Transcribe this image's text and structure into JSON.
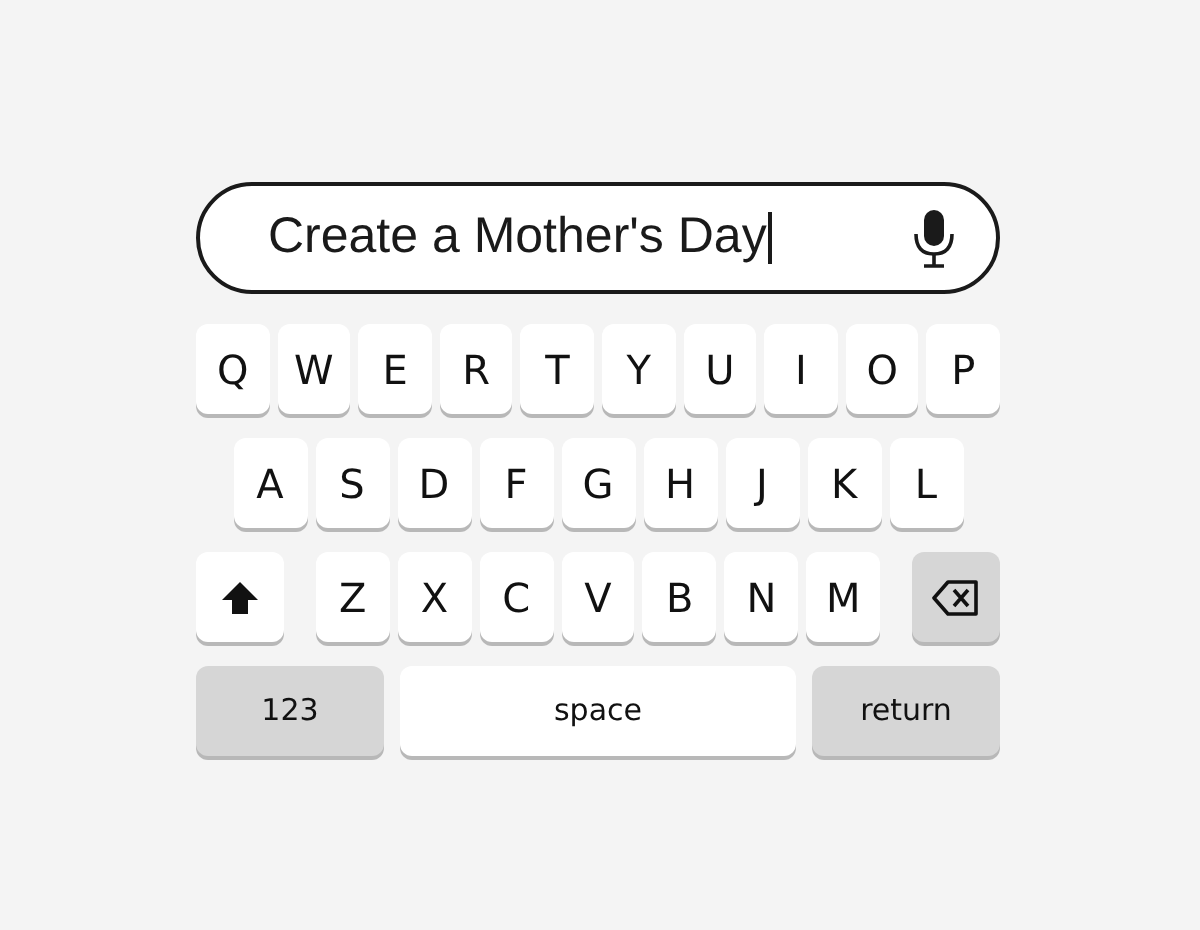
{
  "search": {
    "value": "Create a Mother's Day"
  },
  "keyboard": {
    "rows": [
      [
        {
          "kind": "letter",
          "label": "Q"
        },
        {
          "kind": "letter",
          "label": "W"
        },
        {
          "kind": "letter",
          "label": "E"
        },
        {
          "kind": "letter",
          "label": "R"
        },
        {
          "kind": "letter",
          "label": "T"
        },
        {
          "kind": "letter",
          "label": "Y"
        },
        {
          "kind": "letter",
          "label": "U"
        },
        {
          "kind": "letter",
          "label": "I"
        },
        {
          "kind": "letter",
          "label": "O"
        },
        {
          "kind": "letter",
          "label": "P"
        }
      ],
      [
        {
          "kind": "letter",
          "label": "A"
        },
        {
          "kind": "letter",
          "label": "S"
        },
        {
          "kind": "letter",
          "label": "D"
        },
        {
          "kind": "letter",
          "label": "F"
        },
        {
          "kind": "letter",
          "label": "G"
        },
        {
          "kind": "letter",
          "label": "H"
        },
        {
          "kind": "letter",
          "label": "J"
        },
        {
          "kind": "letter",
          "label": "K"
        },
        {
          "kind": "letter",
          "label": "L"
        }
      ],
      [
        {
          "kind": "shift"
        },
        {
          "kind": "letter",
          "label": "Z"
        },
        {
          "kind": "letter",
          "label": "X"
        },
        {
          "kind": "letter",
          "label": "C"
        },
        {
          "kind": "letter",
          "label": "V"
        },
        {
          "kind": "letter",
          "label": "B"
        },
        {
          "kind": "letter",
          "label": "N"
        },
        {
          "kind": "letter",
          "label": "M"
        },
        {
          "kind": "backspace"
        }
      ]
    ],
    "bottom_keys": [
      {
        "kind": "mode",
        "label": "123"
      },
      {
        "kind": "space",
        "label": "space"
      },
      {
        "kind": "return",
        "label": "return"
      }
    ]
  }
}
